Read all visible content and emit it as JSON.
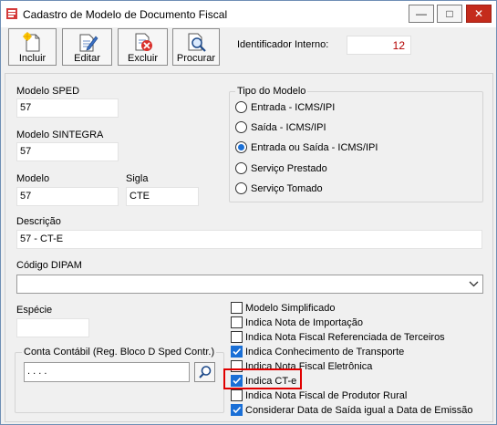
{
  "window": {
    "title": "Cadastro de Modelo de Documento Fiscal",
    "minimize_glyph": "—",
    "maximize_glyph": "□",
    "close_glyph": "✕"
  },
  "toolbar": {
    "incluir_label": "Incluir",
    "editar_label": "Editar",
    "excluir_label": "Excluir",
    "procurar_label": "Procurar"
  },
  "identificador": {
    "label": "Identificador Interno:",
    "value": "12"
  },
  "form": {
    "modelo_sped": {
      "label": "Modelo SPED",
      "value": "57"
    },
    "modelo_sintegra": {
      "label": "Modelo SINTEGRA",
      "value": "57"
    },
    "modelo": {
      "label": "Modelo",
      "value": "57"
    },
    "sigla": {
      "label": "Sigla",
      "value": "CTE"
    },
    "descricao": {
      "label": "Descrição",
      "value": "57 - CT-E"
    },
    "codigo_dipam": {
      "label": "Código DIPAM",
      "value": ""
    },
    "especie": {
      "label": "Espécie",
      "value": ""
    },
    "conta_contabil": {
      "label": "Conta Contábil (Reg. Bloco D Sped Contr.)",
      "value": ". . . ."
    }
  },
  "tipo_modelo": {
    "title": "Tipo do Modelo",
    "options": [
      {
        "label": "Entrada - ICMS/IPI",
        "selected": false
      },
      {
        "label": "Saída - ICMS/IPI",
        "selected": false
      },
      {
        "label": "Entrada ou Saída - ICMS/IPI",
        "selected": true
      },
      {
        "label": "Serviço Prestado",
        "selected": false
      },
      {
        "label": "Serviço Tomado",
        "selected": false
      }
    ]
  },
  "checkboxes": [
    {
      "label": "Modelo Simplificado",
      "checked": false
    },
    {
      "label": "Indica Nota de Importação",
      "checked": false
    },
    {
      "label": "Indica Nota Fiscal Referenciada de Terceiros",
      "checked": false
    },
    {
      "label": "Indica Conhecimento de Transporte",
      "checked": true
    },
    {
      "label": "Indica Nota Fiscal Eletrônica",
      "checked": false
    },
    {
      "label": "Indica CT-e",
      "checked": true
    },
    {
      "label": "Indica Nota Fiscal de Produtor Rural",
      "checked": false
    },
    {
      "label": "Considerar Data de Saída igual a Data de Emissão",
      "checked": true
    }
  ],
  "colors": {
    "accent": "#1a6fd6",
    "highlight": "#e00000",
    "id_value": "#b30000"
  }
}
